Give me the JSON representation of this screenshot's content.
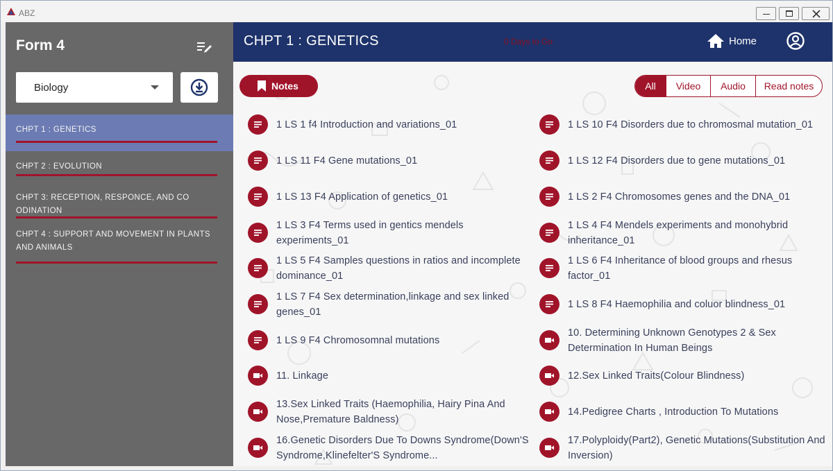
{
  "window": {
    "title": "ABZ"
  },
  "sidebar": {
    "form_title": "Form 4",
    "subject": "Biology",
    "chapters": [
      {
        "label": "CHPT 1 : GENETICS",
        "active": true
      },
      {
        "label": "CHPT  2 : EVOLUTION",
        "active": false
      },
      {
        "label": "CHPT  3: RECEPTION, RESPONCE, AND  CO ODINATION",
        "active": false
      },
      {
        "label": "CHPT  4 : SUPPORT  AND MOVEMENT IN PLANTS AND ANIMALS",
        "active": false
      }
    ]
  },
  "header": {
    "chapter_title": "CHPT 1 : GENETICS",
    "days_text": "0 Days to Go",
    "home_label": "Home"
  },
  "toolbar": {
    "notes_label": "Notes",
    "filters": [
      {
        "label": "All",
        "active": true
      },
      {
        "label": "Video",
        "active": false
      },
      {
        "label": "Audio",
        "active": false
      },
      {
        "label": "Read notes",
        "active": false
      }
    ]
  },
  "items": [
    {
      "title": "1 LS 1 f4   Introduction and variations_01",
      "type": "note"
    },
    {
      "title": "1 LS 10 F4  Disorders due to chromosmal mutation_01",
      "type": "note"
    },
    {
      "title": "1 LS 11 F4  Gene mutations_01",
      "type": "note"
    },
    {
      "title": "1 LS 12 F4  Disorders due to gene mutations_01",
      "type": "note"
    },
    {
      "title": "1 LS 13 F4  Application of genetics_01",
      "type": "note"
    },
    {
      "title": "1 LS 2 F4 Chromosomes genes and the DNA_01",
      "type": "note"
    },
    {
      "title": "1 LS 3 F4  Terms used in gentics mendels experiments_01",
      "type": "note"
    },
    {
      "title": "1 LS 4 F4  Mendels experiments and monohybrid inheritance_01",
      "type": "note"
    },
    {
      "title": "1 LS 5 F4  Samples questions in ratios and incomplete dominance_01",
      "type": "note"
    },
    {
      "title": "1 LS 6 F4  Inheritance of blood groups and rhesus factor_01",
      "type": "note"
    },
    {
      "title": "1 LS 7 F4  Sex determination,linkage and sex linked genes_01",
      "type": "note"
    },
    {
      "title": "1 LS 8 F4  Haemophilia and coluor blindness_01",
      "type": "note"
    },
    {
      "title": "1 LS 9 F4  Chromosomnal mutations",
      "type": "note"
    },
    {
      "title": "10. Determining Unknown Genotypes 2 & Sex Determination In Human Beings",
      "type": "video"
    },
    {
      "title": "11. Linkage",
      "type": "video"
    },
    {
      "title": "12.Sex Linked Traits(Colour Blindness)",
      "type": "video"
    },
    {
      "title": "13.Sex Linked Traits (Haemophilia, Hairy Pina And Nose,Premature Baldness)",
      "type": "video"
    },
    {
      "title": "14.Pedigree Charts , Introduction To Mutations",
      "type": "video"
    },
    {
      "title": "16.Genetic Disorders Due To Downs Syndrome(Down'S Syndrome,Klinefelter'S Syndrome...",
      "type": "video"
    },
    {
      "title": "17.Polyploidy(Part2), Genetic Mutations(Substitution And Inversion)",
      "type": "video"
    }
  ],
  "colors": {
    "accent": "#a0142a",
    "header": "#1e336b",
    "sidebar": "#686868",
    "active_chapter": "#6c7bb3"
  },
  "icons": {
    "app": "abz-logo-icon",
    "edit": "edit-list-icon",
    "download": "download-circle-icon",
    "home": "home-icon",
    "user": "user-circle-icon",
    "notes": "bookmark-icon",
    "note_item": "document-lines-icon",
    "video_item": "video-camera-icon"
  }
}
